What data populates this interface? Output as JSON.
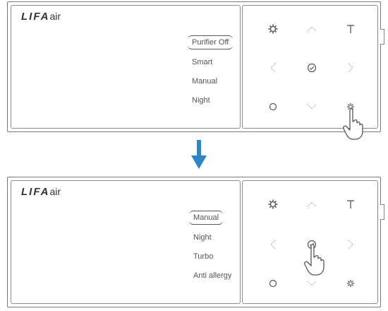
{
  "top_panel": {
    "logo": {
      "brand": "LIFA",
      "suffix": "air"
    },
    "menu": [
      "Purifier Off",
      "Smart",
      "Manual",
      "Night"
    ],
    "selected_index": 0
  },
  "bottom_panel": {
    "logo": {
      "brand": "LIFA",
      "suffix": "air"
    },
    "menu": [
      "Manual",
      "Night",
      "Turbo",
      "Anti allergy"
    ],
    "selected_index": 0
  },
  "keypad_icons": [
    "settings-icon",
    "up-icon",
    "timer-icon",
    "left-icon",
    "confirm-icon",
    "right-icon",
    "power-icon",
    "down-icon",
    "fan-icon"
  ],
  "colors": {
    "arrow": "#2a86c8",
    "outline": "#7a7a7a"
  }
}
